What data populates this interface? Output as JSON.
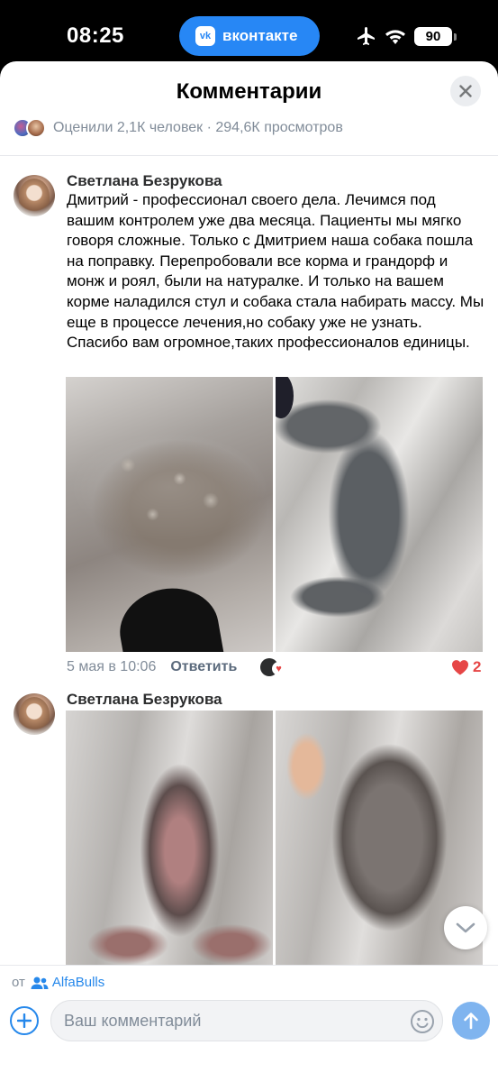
{
  "status_bar": {
    "time": "08:25",
    "app_pill": "вконтакте",
    "app_logo": "vk",
    "battery": "90"
  },
  "sheet": {
    "title": "Комментарии",
    "stats": "Оценили 2,1К человек · 294,6К просмотров"
  },
  "comments": [
    {
      "author": "Светлана Безрукова",
      "text": "Дмитрий - профессионал своего дела. Лечимся под вашим контролем уже два месяца. Пациенты мы мягко говоря сложные. Только с Дмитрием наша собака пошла на поправку. Перепробовали все корма и грандорф и монж и роял, были на натуралке. И только на вашем корме наладился стул и собака стала набирать массу. Мы еще в процессе лечения,но собаку уже не узнать. Спасибо вам огромное,таких профессионалов единицы.",
      "date": "5 мая в 10:06",
      "reply_label": "Ответить",
      "likes": "2"
    },
    {
      "author": "Светлана Безрукова"
    }
  ],
  "composer": {
    "from_prefix": "от",
    "from_name": "AlfaBulls",
    "placeholder": "Ваш комментарий"
  },
  "colors": {
    "accent": "#2688eb",
    "vk_blue": "#2787f5",
    "like_red": "#e64646",
    "secondary_text": "#818c99"
  },
  "icons": [
    "vk-logo-icon",
    "airplane-icon",
    "wifi-icon",
    "battery-icon",
    "close-icon",
    "heart-icon",
    "chevron-down-icon",
    "group-icon",
    "plus-icon",
    "emoji-icon",
    "send-arrow-icon"
  ]
}
